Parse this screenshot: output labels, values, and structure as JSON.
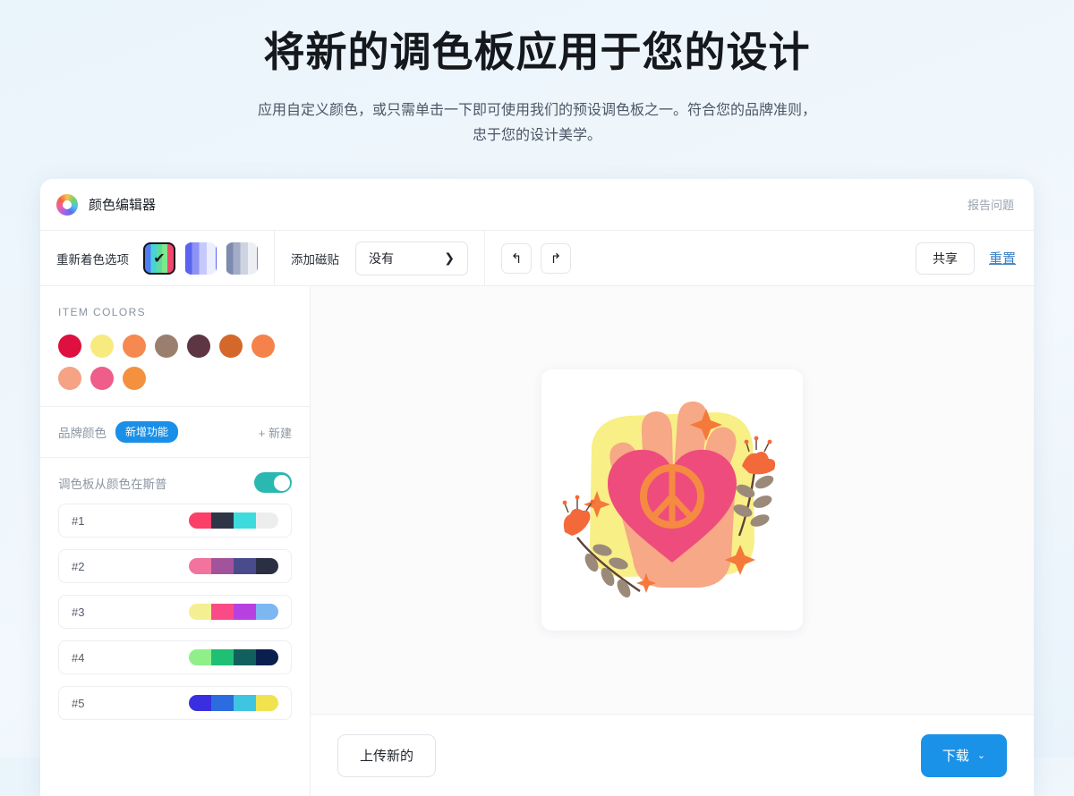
{
  "hero": {
    "title": "将新的调色板应用于您的设计",
    "subtitle": "应用自定义颜色，或只需单击一下即可使用我们的预设调色板之一。符合您的品牌准则，忠于您的设计美学。"
  },
  "topbar": {
    "brand_name": "颜色编辑器",
    "brand_icon": "color-wheel-icon",
    "report_label": "报告问题"
  },
  "toolbar": {
    "recolor_label": "重新着色选项",
    "recolor_options": [
      {
        "id": "t1",
        "selected": true,
        "check": "✔"
      },
      {
        "id": "t2",
        "selected": false
      },
      {
        "id": "t3",
        "selected": false
      }
    ],
    "tile_label": "添加磁贴",
    "tile_value": "没有",
    "tile_chevron": "❯",
    "undo_icon": "↰",
    "redo_icon": "↱",
    "share_label": "共享",
    "reset_label": "重置"
  },
  "sidebar": {
    "item_colors_title": "ITEM COLORS",
    "item_colors": [
      "#dd103f",
      "#f7eb80",
      "#f5894f",
      "#9a7f6f",
      "#5e3543",
      "#d4682a",
      "#f5824a",
      "#f5a285",
      "#ef5d8a",
      "#f4913f"
    ],
    "brand_colors_label": "品牌颜色",
    "brand_badge": "新增功能",
    "new_link": "+ 新建",
    "palette_toggle_label": "调色板从颜色在斯普",
    "palette_toggle_on": true,
    "palette_toggle_color": "#2ab8b0",
    "palettes": [
      {
        "name": "#1",
        "colors": [
          "#fc3f69",
          "#2e3547",
          "#3ddbdb",
          "#ededee"
        ]
      },
      {
        "name": "#2",
        "colors": [
          "#f2739d",
          "#a3539b",
          "#4a4b8c",
          "#2b2f44"
        ]
      },
      {
        "name": "#3",
        "colors": [
          "#f4ef93",
          "#fa4b87",
          "#b741e0",
          "#7db7f2"
        ]
      },
      {
        "name": "#4",
        "colors": [
          "#8ff08a",
          "#1fc074",
          "#12605e",
          "#0b1f4f"
        ]
      },
      {
        "name": "#5",
        "colors": [
          "#3a2fe0",
          "#2b6de0",
          "#3ec5e0",
          "#f0e350"
        ]
      }
    ]
  },
  "canvas": {
    "artwork_name": "hand-holding-peace-heart-illustration",
    "artwork_colors": {
      "blob": "#f8ef86",
      "hand": "#f6a887",
      "heart": "#ee4c7c",
      "peace": "#f58a42",
      "sparkle": "#f4793b",
      "flower": "#f4693a",
      "leaf": "#9b8a7a",
      "stem": "#5f4237"
    }
  },
  "footer": {
    "upload_label": "上传新的",
    "download_label": "下载",
    "download_caret": "⌄",
    "download_color": "#1a92e8"
  }
}
